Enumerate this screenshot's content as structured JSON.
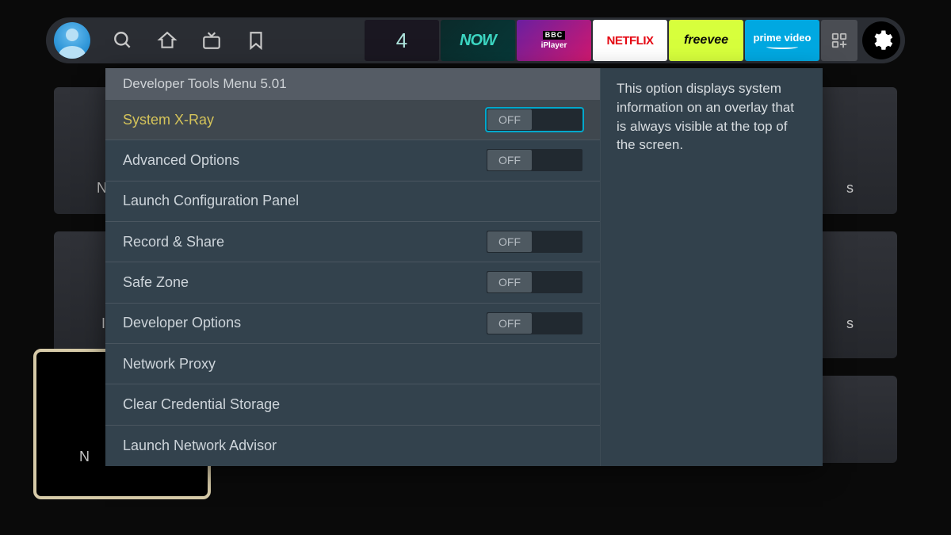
{
  "topnav": {
    "apps": [
      {
        "name": "channel4",
        "label": "4"
      },
      {
        "name": "now",
        "label": "NOW"
      },
      {
        "name": "iplayer",
        "brand": "BBC",
        "label": "iPlayer"
      },
      {
        "name": "netflix",
        "label": "NETFLIX"
      },
      {
        "name": "freevee",
        "label": "freevee"
      },
      {
        "name": "prime",
        "label": "prime video"
      }
    ]
  },
  "menu": {
    "title": "Developer Tools Menu 5.01",
    "items": [
      {
        "label": "System X-Ray",
        "toggle": "OFF",
        "selected": true,
        "focused": true
      },
      {
        "label": "Advanced Options",
        "toggle": "OFF"
      },
      {
        "label": "Launch Configuration Panel"
      },
      {
        "label": "Record & Share",
        "toggle": "OFF"
      },
      {
        "label": "Safe Zone",
        "toggle": "OFF"
      },
      {
        "label": "Developer Options",
        "toggle": "OFF"
      },
      {
        "label": "Network Proxy"
      },
      {
        "label": "Clear Credential Storage"
      },
      {
        "label": "Launch Network Advisor"
      }
    ]
  },
  "description": "This option displays system information on an overlay that is always visible at the top of the screen.",
  "bg_letters": [
    "N",
    "s",
    "I",
    "s",
    "N"
  ]
}
